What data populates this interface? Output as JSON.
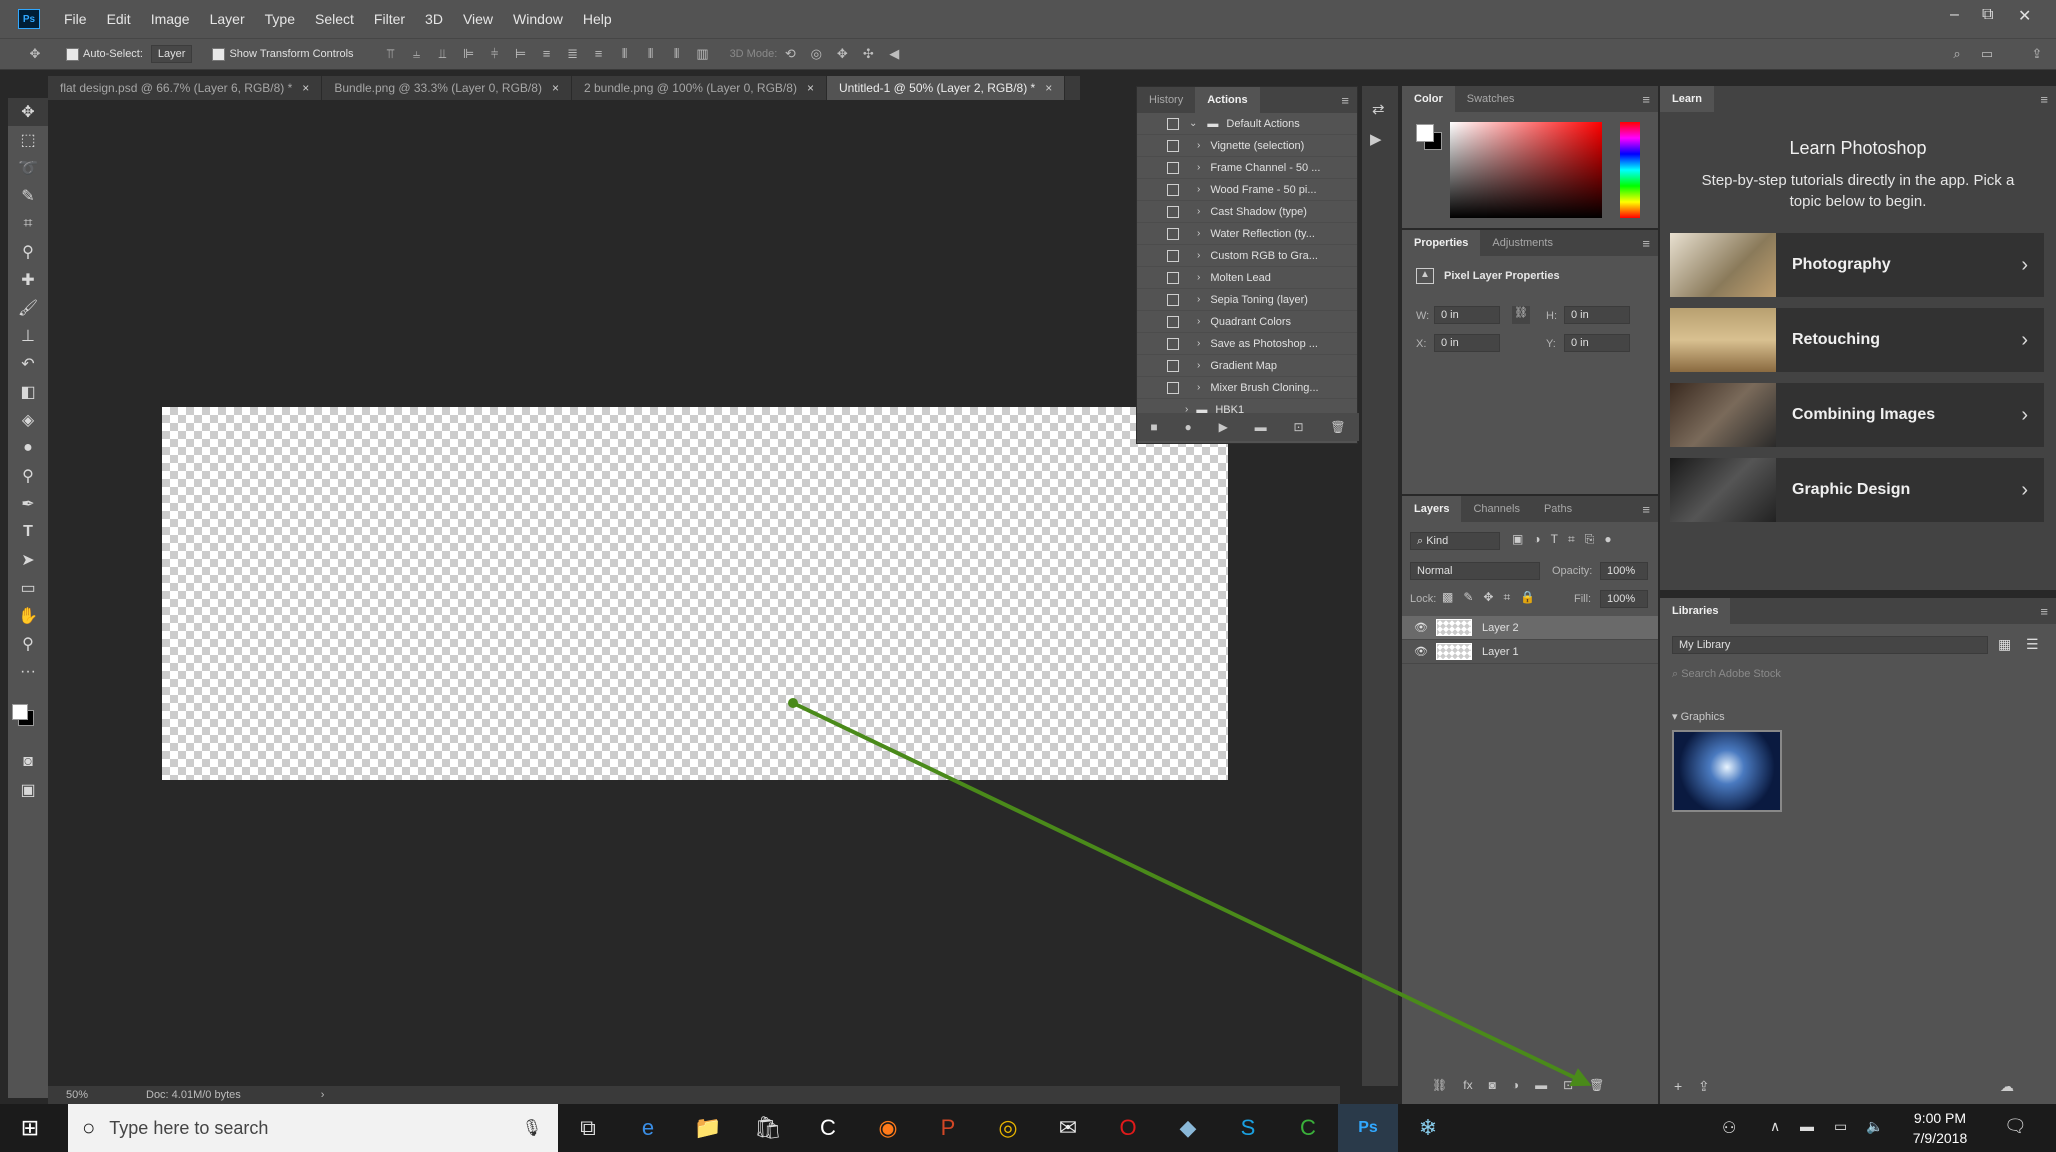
{
  "menubar": {
    "app_logo": "Ps",
    "items": [
      "File",
      "Edit",
      "Image",
      "Layer",
      "Type",
      "Select",
      "Filter",
      "3D",
      "View",
      "Window",
      "Help"
    ],
    "window_controls": {
      "minimize": "–",
      "restore": "⧉",
      "close": "✕"
    }
  },
  "options": {
    "auto_select_label": "Auto-Select:",
    "auto_select_value": "Layer",
    "transform_label": "Show Transform Controls",
    "mode_3d_label": "3D Mode:"
  },
  "tabs": [
    {
      "label": "flat design.psd @ 66.7% (Layer 6, RGB/8) *"
    },
    {
      "label": "Bundle.png @ 33.3% (Layer 0, RGB/8)"
    },
    {
      "label": "2 bundle.png @ 100% (Layer 0, RGB/8)"
    },
    {
      "label": "Untitled-1 @ 50% (Layer 2, RGB/8) *"
    }
  ],
  "status": {
    "zoom": "50%",
    "doc": "Doc: 4.01M/0 bytes"
  },
  "actions_panel": {
    "tabs": [
      "History",
      "Actions"
    ],
    "folder": "Default Actions",
    "items": [
      "Vignette (selection)",
      "Frame Channel - 50 ...",
      "Wood Frame - 50 pi...",
      "Cast Shadow (type)",
      "Water Reflection (ty...",
      "Custom RGB to Gra...",
      "Molten Lead",
      "Sepia Toning (layer)",
      "Quadrant Colors",
      "Save as Photoshop ...",
      "Gradient Map",
      "Mixer Brush Cloning..."
    ],
    "last_folder": "HBK1"
  },
  "color_panel": {
    "tabs": [
      "Color",
      "Swatches"
    ],
    "fg": "#ffffff",
    "bg": "#000000"
  },
  "properties_panel": {
    "tabs": [
      "Properties",
      "Adjustments"
    ],
    "title": "Pixel Layer Properties",
    "w_label": "W:",
    "w_value": "0 in",
    "h_label": "H:",
    "h_value": "0 in",
    "x_label": "X:",
    "x_value": "0 in",
    "y_label": "Y:",
    "y_value": "0 in"
  },
  "layers_panel": {
    "tabs": [
      "Layers",
      "Channels",
      "Paths"
    ],
    "kind": "Kind",
    "blend": "Normal",
    "opacity_label": "Opacity:",
    "opacity": "100%",
    "lock_label": "Lock:",
    "fill_label": "Fill:",
    "fill": "100%",
    "layers": [
      {
        "name": "Layer 2",
        "selected": true
      },
      {
        "name": "Layer 1",
        "selected": false
      }
    ]
  },
  "learn_panel": {
    "tab": "Learn",
    "title": "Learn Photoshop",
    "subtitle": "Step-by-step tutorials directly in the app. Pick a topic below to begin.",
    "cards": [
      {
        "label": "Photography"
      },
      {
        "label": "Retouching"
      },
      {
        "label": "Combining Images"
      },
      {
        "label": "Graphic Design"
      }
    ]
  },
  "libraries_panel": {
    "tab": "Libraries",
    "library": "My Library",
    "search_placeholder": "Search Adobe Stock",
    "section": "Graphics"
  },
  "taskbar": {
    "search_placeholder": "Type here to search",
    "time": "9:00 PM",
    "date": "7/9/2018"
  },
  "colors": {
    "annotation_arrow": "#4a8a1a",
    "accent": "#31a8ff"
  }
}
